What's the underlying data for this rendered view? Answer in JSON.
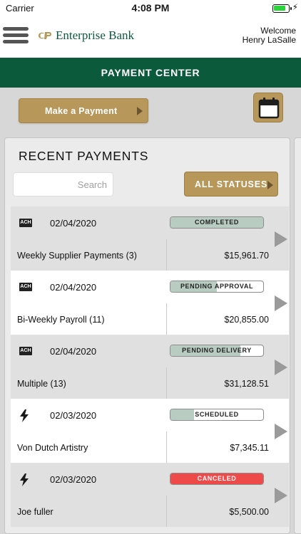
{
  "status_bar": {
    "carrier": "Carrier",
    "time": "4:08 PM",
    "battery_level": 0.85
  },
  "header": {
    "brand": "Enterprise Bank",
    "welcome_line1": "Welcome",
    "welcome_line2": "Henry LaSalle"
  },
  "title": "PAYMENT CENTER",
  "toolbar": {
    "make_payment_label": "Make a Payment",
    "calendar_icon": "calendar-icon"
  },
  "recent": {
    "title": "RECENT PAYMENTS",
    "search_placeholder": "Search",
    "filter_label": "ALL STATUSES",
    "payments": [
      {
        "type": "ACH",
        "date": "02/04/2020",
        "payee": "Weekly Supplier Payments (3)",
        "amount": "$15,961.70",
        "status": "COMPLETED",
        "progress": 1.0,
        "status_color": "#b8ccc2"
      },
      {
        "type": "ACH",
        "date": "02/04/2020",
        "payee": "Bi-Weekly Payroll (11)",
        "amount": "$20,855.00",
        "status": "PENDING APPROVAL",
        "progress": 0.5,
        "status_color": "#b8ccc2"
      },
      {
        "type": "ACH",
        "date": "02/04/2020",
        "payee": "Multiple (13)",
        "amount": "$31,128.51",
        "status": "PENDING DELIVERY",
        "progress": 0.75,
        "status_color": "#b8ccc2"
      },
      {
        "type": "WIRE",
        "date": "02/03/2020",
        "payee": "Von Dutch Artistry",
        "amount": "$7,345.11",
        "status": "SCHEDULED",
        "progress": 0.25,
        "status_color": "#b8ccc2"
      },
      {
        "type": "WIRE",
        "date": "02/03/2020",
        "payee": "Joe fuller",
        "amount": "$5,500.00",
        "status": "CANCELED",
        "progress": 1.0,
        "status_color": "#ee4a4a"
      }
    ]
  }
}
